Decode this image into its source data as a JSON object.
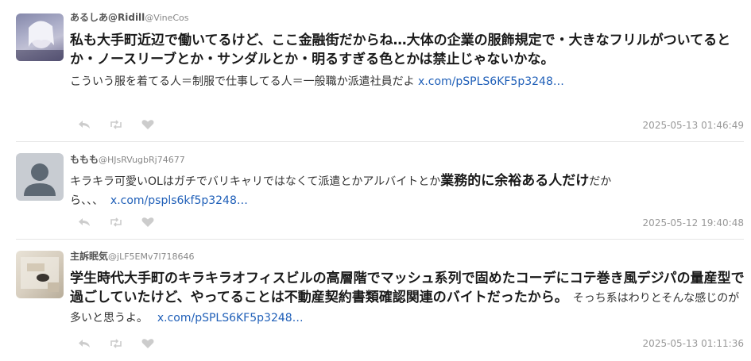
{
  "tweets": [
    {
      "name": "あるしあ@Ridill",
      "handle": "@VineCos",
      "text_big": "私も大手町近辺で働いてるけど、ここ金融街だからね…大体の企業の服飾規定で・大きなフリルがついてるとか・ノースリーブとか・サンダルとか・明るすぎる色とかは禁止じゃないかな。",
      "text_small": "こういう服を着てる人＝制服で仕事してる人＝一般職か派遣社員だよ",
      "link": "x.com/pSPLS6KF5p3248…",
      "timestamp": "2025-05-13 01:46:49"
    },
    {
      "name": "ももも",
      "handle": "@HJsRVugbRj74677",
      "text_small_pre": "キラキラ可愛いOLはガチでバリキャリではなくて派遣とかアルバイトとか",
      "text_big": "業務的に余裕ある人だけ",
      "text_small_post": "だから、、、",
      "link": "x.com/pspls6kf5p3248…",
      "timestamp": "2025-05-12 19:40:48"
    },
    {
      "name": "主訴眠気",
      "handle": "@jLF5EMv7l718646",
      "text_big": "学生時代大手町のキラキラオフィスビルの高層階でマッシュ系列で固めたコーデにコテ巻き風デジパの量産型で過ごしていたけど、やってることは不動産契約書類確認関連のバイトだったから。",
      "text_small": "そっち系はわりとそんな感じのが多いと思うよ。",
      "link": "x.com/pSPLS6KF5p3248…",
      "timestamp": "2025-05-13 01:11:36"
    }
  ],
  "icons": [
    "reply-icon",
    "retweet-icon",
    "like-icon"
  ],
  "colors": {
    "link": "#1f5fb8",
    "icon": "#cccccc",
    "divider": "#e6e6e6"
  }
}
